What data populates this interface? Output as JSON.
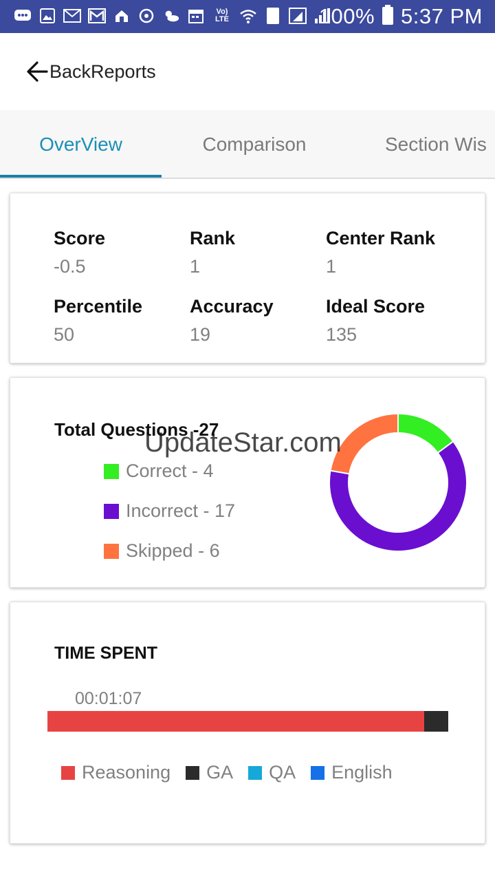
{
  "status_bar": {
    "battery": "100%",
    "time": "5:37 PM",
    "network_label": "Vo) LTE",
    "sim": "1",
    "icons": [
      "messages-icon",
      "gallery-icon",
      "email-icon",
      "gmail-icon",
      "app-icon",
      "sync-icon",
      "weather-icon",
      "calendar-icon",
      "volte-icon",
      "wifi-icon",
      "sim1-icon",
      "signal-r-icon",
      "signal-icon",
      "battery-icon"
    ]
  },
  "header": {
    "back_label": "BackReports"
  },
  "tabs": [
    {
      "label": "OverView",
      "active": true
    },
    {
      "label": "Comparison",
      "active": false
    },
    {
      "label": "Section Wis",
      "active": false
    }
  ],
  "stats": [
    {
      "label": "Score",
      "value": "-0.5"
    },
    {
      "label": "Rank",
      "value": "1"
    },
    {
      "label": "Center Rank",
      "value": "1"
    },
    {
      "label": "Percentile",
      "value": "50"
    },
    {
      "label": "Accuracy",
      "value": "19"
    },
    {
      "label": "Ideal Score",
      "value": "135"
    }
  ],
  "questions": {
    "title": "Total Questions -27",
    "watermark": "UpdateStar.com",
    "legend": [
      {
        "label": "Correct - 4",
        "color": "#33ee22"
      },
      {
        "label": "Incorrect - 17",
        "color": "#6a0fd0"
      },
      {
        "label": "Skipped - 6",
        "color": "#ff7340"
      }
    ]
  },
  "chart_data": {
    "type": "pie",
    "categories": [
      "Correct",
      "Incorrect",
      "Skipped"
    ],
    "values": [
      4,
      17,
      6
    ],
    "colors": [
      "#33ee22",
      "#6a0fd0",
      "#ff7340"
    ],
    "donut": true
  },
  "time_spent": {
    "title": "TIME SPENT",
    "time": "00:01:07",
    "segments": [
      {
        "name": "Reasoning",
        "fraction": 0.94,
        "color": "#e84343"
      },
      {
        "name": "GA",
        "fraction": 0.06,
        "color": "#2b2b2b"
      },
      {
        "name": "QA",
        "fraction": 0,
        "color": "#16a8d8"
      },
      {
        "name": "English",
        "fraction": 0,
        "color": "#1670e8"
      }
    ],
    "legend": [
      {
        "label": "Reasoning",
        "color": "#e84343"
      },
      {
        "label": "GA",
        "color": "#2b2b2b"
      },
      {
        "label": "QA",
        "color": "#16a8d8"
      },
      {
        "label": "English",
        "color": "#1670e8"
      }
    ]
  }
}
